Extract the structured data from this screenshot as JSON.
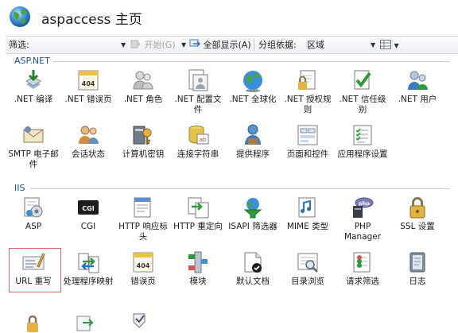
{
  "header": {
    "title": "aspaccess 主页"
  },
  "toolbar": {
    "filter_label": "筛选:",
    "start_label": "开始(G)",
    "show_all_label": "全部显示(A)",
    "group_by_label": "分组依据:",
    "group_by_value": "区域"
  },
  "groups": [
    {
      "name": "ASP.NET",
      "items": [
        {
          "label": ".NET 编译",
          "icon": "download-arrow-icon"
        },
        {
          "label": ".NET 错误页",
          "icon": "error-page-404-icon"
        },
        {
          "label": ".NET 角色",
          "icon": "roles-people-icon"
        },
        {
          "label": ".NET 配置文件",
          "icon": "profile-document-icon"
        },
        {
          "label": ".NET 全球化",
          "icon": "globe-icon"
        },
        {
          "label": ".NET 授权规则",
          "icon": "lock-document-icon"
        },
        {
          "label": ".NET 信任级别",
          "icon": "trust-checkmark-icon"
        },
        {
          "label": ".NET 用户",
          "icon": "users-icon"
        },
        {
          "label": "SMTP 电子邮件",
          "icon": "email-envelope-icon"
        },
        {
          "label": "会话状态",
          "icon": "session-people-icon"
        },
        {
          "label": "计算机密钥",
          "icon": "machine-key-icon"
        },
        {
          "label": "连接字符串",
          "icon": "connection-string-icon"
        },
        {
          "label": "提供程序",
          "icon": "provider-person-icon"
        },
        {
          "label": "页面和控件",
          "icon": "page-controls-icon"
        },
        {
          "label": "应用程序设置",
          "icon": "app-settings-icon"
        }
      ]
    },
    {
      "name": "IIS",
      "items": [
        {
          "label": "ASP",
          "icon": "asp-document-icon"
        },
        {
          "label": "CGI",
          "icon": "cgi-icon"
        },
        {
          "label": "HTTP 响应标头",
          "icon": "response-headers-icon"
        },
        {
          "label": "HTTP 重定向",
          "icon": "redirect-icon"
        },
        {
          "label": "ISAPI 筛选器",
          "icon": "isapi-filter-icon"
        },
        {
          "label": "MIME 类型",
          "icon": "mime-types-icon"
        },
        {
          "label": "PHP Manager",
          "icon": "php-manager-icon"
        },
        {
          "label": "SSL 设置",
          "icon": "ssl-lock-icon"
        },
        {
          "label": "URL 重写",
          "icon": "url-rewrite-icon"
        },
        {
          "label": "处理程序映射",
          "icon": "handler-mappings-icon"
        },
        {
          "label": "错误页",
          "icon": "error-pages-icon"
        },
        {
          "label": "模块",
          "icon": "modules-icon"
        },
        {
          "label": "默认文档",
          "icon": "default-document-icon"
        },
        {
          "label": "目录浏览",
          "icon": "directory-browsing-icon"
        },
        {
          "label": "请求筛选",
          "icon": "request-filtering-icon"
        },
        {
          "label": "日志",
          "icon": "logging-book-icon"
        }
      ]
    }
  ],
  "colors": {
    "group_header": "#1f4f8f",
    "selection_border": "#e06565"
  }
}
